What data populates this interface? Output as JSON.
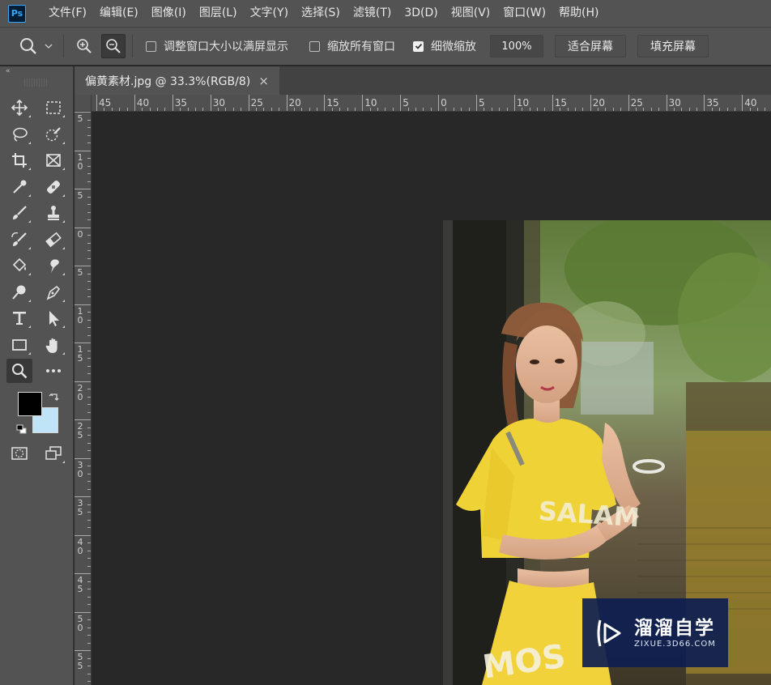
{
  "app": {
    "logo": "Ps"
  },
  "menu": {
    "items": [
      "文件(F)",
      "编辑(E)",
      "图像(I)",
      "图层(L)",
      "文字(Y)",
      "选择(S)",
      "滤镜(T)",
      "3D(D)",
      "视图(V)",
      "窗口(W)",
      "帮助(H)"
    ]
  },
  "options": {
    "resize_windows_label": "调整窗口大小以满屏显示",
    "resize_windows_checked": false,
    "zoom_all_label": "缩放所有窗口",
    "zoom_all_checked": false,
    "scrubby_zoom_label": "细微缩放",
    "scrubby_zoom_checked": true,
    "zoom_value": "100%",
    "fit_screen_label": "适合屏幕",
    "fill_screen_label": "填充屏幕"
  },
  "document": {
    "tab_title": "偏黄素材.jpg @ 33.3%(RGB/8)",
    "close_glyph": "×"
  },
  "rulers": {
    "top_labels": [
      "45",
      "40",
      "35",
      "30",
      "25",
      "20",
      "15",
      "10",
      "5",
      "0",
      "5",
      "10",
      "15",
      "20",
      "25",
      "30",
      "35",
      "40"
    ],
    "left_labels": [
      "5",
      "10",
      "5",
      "0",
      "5",
      "10",
      "15",
      "20",
      "25",
      "30",
      "35",
      "40",
      "45",
      "50",
      "55"
    ]
  },
  "colors": {
    "foreground": "#000000",
    "background": "#bfe3f7",
    "ui_panel": "#535353",
    "canvas": "#282828",
    "accent_ps": "#31a8ff"
  },
  "tools": [
    "move-tool",
    "marquee-tool",
    "lasso-tool",
    "quick-selection-tool",
    "crop-tool",
    "frame-tool",
    "eyedropper-tool",
    "healing-brush-tool",
    "brush-tool",
    "clone-stamp-tool",
    "history-brush-tool",
    "eraser-tool",
    "paint-bucket-tool",
    "smudge-tool",
    "dodge-tool",
    "pen-tool",
    "type-tool",
    "path-selection-tool",
    "rectangle-tool",
    "hand-tool",
    "zoom-tool",
    "more-tools"
  ],
  "watermark": {
    "main_text": "溜溜自学",
    "sub_text": "ZIXUE.3D66.COM"
  }
}
